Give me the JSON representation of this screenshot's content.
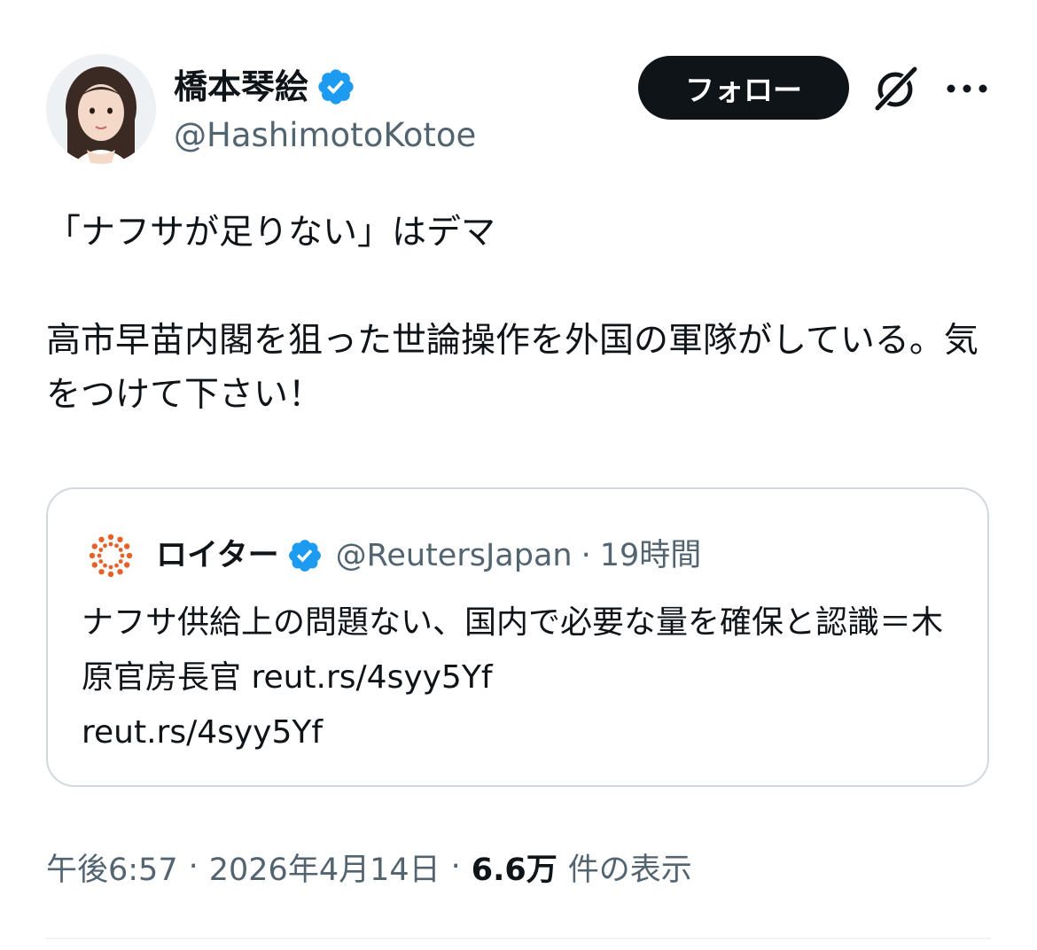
{
  "author": {
    "display_name": "橋本琴絵",
    "handle": "@HashimotoKotoe",
    "verified": true
  },
  "actions": {
    "follow_label": "フォロー",
    "grok_icon": "grok-icon",
    "more_icon": "more-icon"
  },
  "tweet": {
    "text": "「ナフサが足りない」はデマ\n\n高市早苗内閣を狙った世論操作を外国の軍隊がしている。気をつけて下さい！"
  },
  "quote": {
    "name": "ロイター",
    "handle": "@ReutersJapan",
    "separator": "·",
    "time": "19時間",
    "text": "ナフサ供給上の問題ない、国内で必要な量を確保と認識＝木原官房長官 reut.rs/4syy5Yf\nreut.rs/4syy5Yf"
  },
  "meta": {
    "time": "午後6:57",
    "date": "2026年4月14日",
    "separator": "·",
    "views_count": "6.6万",
    "views_label": "件の表示"
  },
  "colors": {
    "text": "#0f1419",
    "secondary": "#536471",
    "verified_blue": "#1d9bf0",
    "border": "#cfd9de",
    "reuters_orange": "#e3622a"
  }
}
